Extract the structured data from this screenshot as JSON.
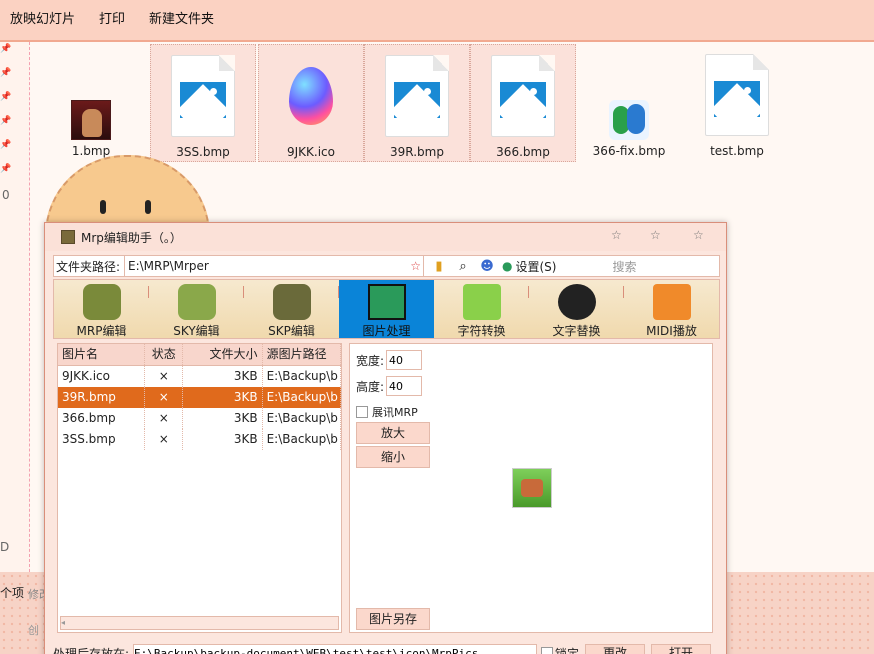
{
  "menu": {
    "slideshow": "放映幻灯片",
    "print": "打印",
    "new_folder": "新建文件夹"
  },
  "left_pane": {
    "numbers": [
      "0",
      "D"
    ]
  },
  "files": [
    {
      "name": "1.bmp"
    },
    {
      "name": "3SS.bmp"
    },
    {
      "name": "9JKK.ico"
    },
    {
      "name": "39R.bmp"
    },
    {
      "name": "366.bmp"
    },
    {
      "name": "366-fix.bmp"
    },
    {
      "name": "test.bmp"
    }
  ],
  "bottom": {
    "items_text": "个项",
    "edit_text": "修改",
    "create_text": "创"
  },
  "window": {
    "title": "Mrp编辑助手（。）",
    "address_label": "文件夹路径:",
    "address_value": "E:\\MRP\\Mrper",
    "settings_label": "设置(S)",
    "search_placeholder": "搜索",
    "tabs": [
      {
        "label": "MRP编辑"
      },
      {
        "label": "SKY编辑"
      },
      {
        "label": "SKP编辑"
      },
      {
        "label": "图片处理"
      },
      {
        "label": "字符转换"
      },
      {
        "label": "文字替换"
      },
      {
        "label": "MIDI播放"
      }
    ],
    "table": {
      "headers": [
        "图片名",
        "状态",
        "文件大小",
        "源图片路径"
      ],
      "rows": [
        [
          "9JKK.ico",
          "×",
          "3KB",
          "E:\\Backup\\b"
        ],
        [
          "39R.bmp",
          "×",
          "3KB",
          "E:\\Backup\\b"
        ],
        [
          "366.bmp",
          "×",
          "3KB",
          "E:\\Backup\\b"
        ],
        [
          "3SS.bmp",
          "×",
          "3KB",
          "E:\\Backup\\b"
        ]
      ]
    },
    "props": {
      "width_label": "宽度:",
      "width_value": "40",
      "height_label": "高度:",
      "height_value": "40",
      "expand_label": "展讯MRP",
      "zoom_in": "放大",
      "zoom_out": "缩小",
      "save_as": "图片另存"
    },
    "bottom_path": {
      "label": "处理后存放在:",
      "value": "E:\\Backup\\backup-document\\WEB\\test\\test\\icon\\MrpPics",
      "lock_label": "锁定",
      "change_label": "更改",
      "open_label": "打开"
    }
  }
}
